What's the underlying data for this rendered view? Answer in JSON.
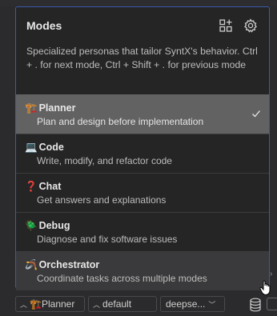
{
  "panel": {
    "title": "Modes",
    "description": "Specialized personas that tailor SyntX's behavior. Ctrl + . for next mode, Ctrl + Shift + . for previous mode"
  },
  "header_icons": [
    "grid-plus-icon",
    "gear-icon"
  ],
  "modes": [
    {
      "emoji": "🏗️",
      "name": "Planner",
      "desc": "Plan and design before implementation",
      "selected": true
    },
    {
      "emoji": "💻",
      "name": "Code",
      "desc": "Write, modify, and refactor code",
      "selected": false
    },
    {
      "emoji": "❓",
      "name": "Chat",
      "desc": "Get answers and explanations",
      "selected": false
    },
    {
      "emoji": "🪲",
      "name": "Debug",
      "desc": "Diagnose and fix software issues",
      "selected": false
    },
    {
      "emoji": "🪃",
      "name": "Orchestrator",
      "desc": "Coordinate tasks across multiple modes",
      "selected": false
    }
  ],
  "bottom_bar": {
    "mode_selector": {
      "emoji": "🏗️",
      "label": "Planner"
    },
    "profile_selector": {
      "label": "default"
    },
    "model_selector": {
      "label": "deepse..."
    }
  },
  "colors": {
    "panel_border": "#3a5aa8",
    "selected_bg": "#626262",
    "hover_bg": "#3a3a3c"
  }
}
